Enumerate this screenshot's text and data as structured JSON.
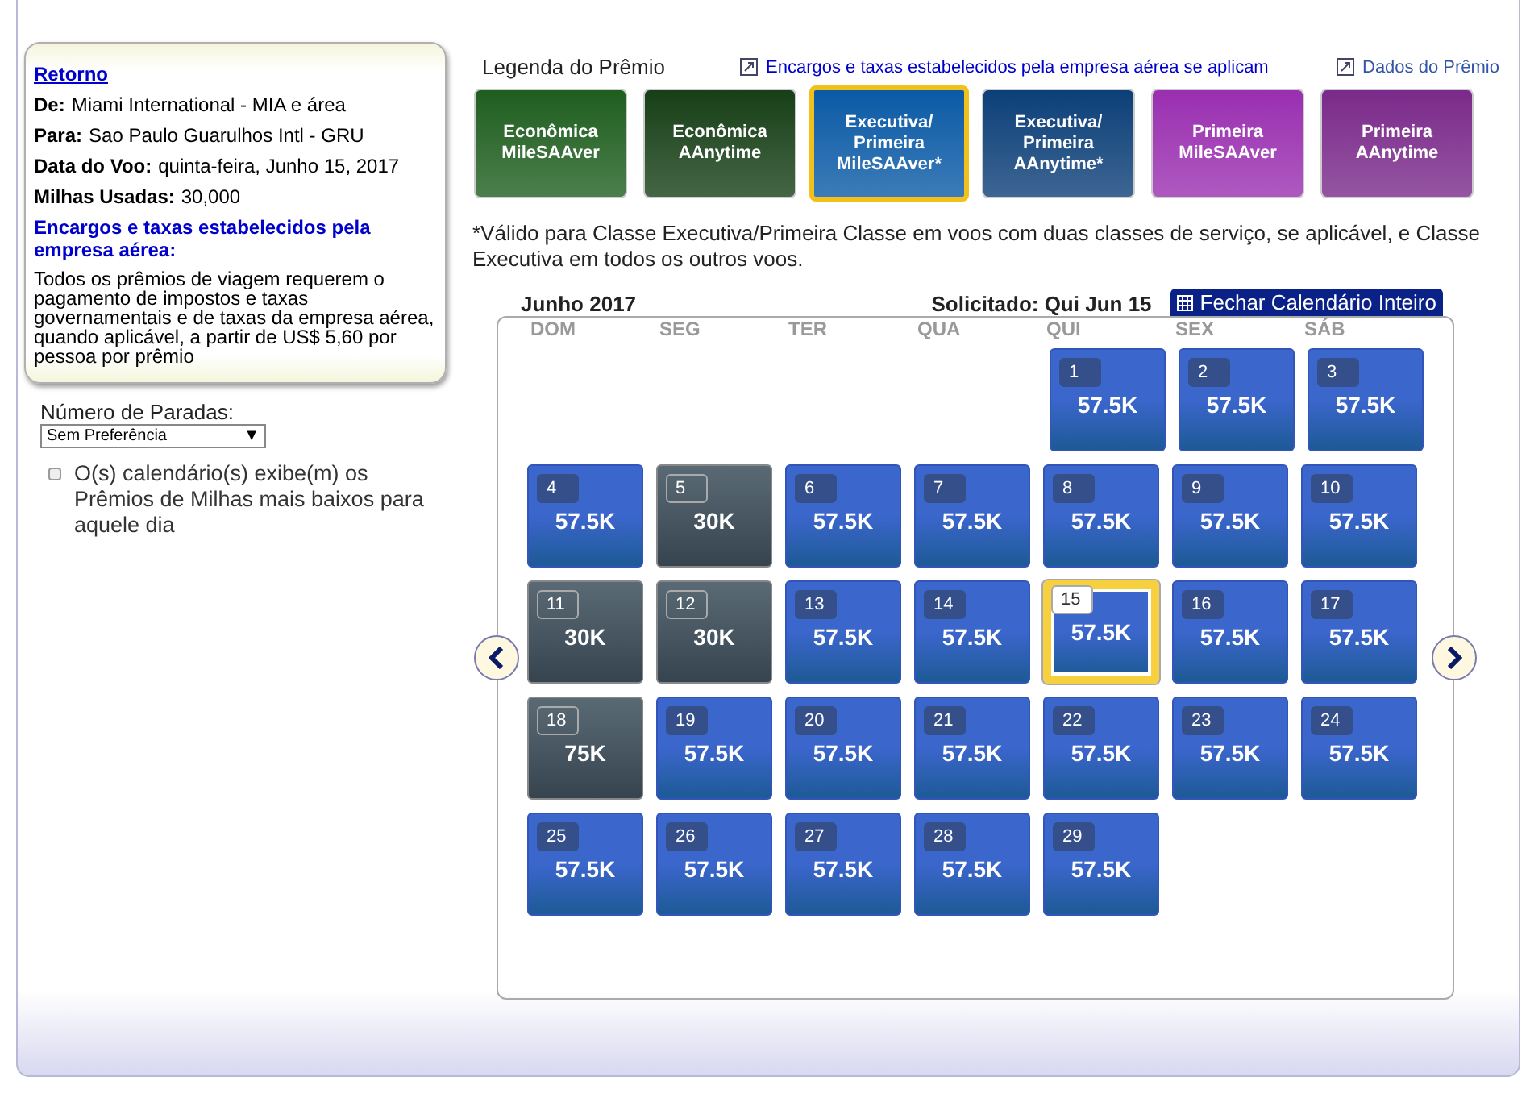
{
  "summary": {
    "back_link": "Retorno",
    "fields": [
      {
        "label": "De:",
        "value": "Miami International - MIA e área"
      },
      {
        "label": "Para:",
        "value": "Sao Paulo Guarulhos Intl - GRU"
      },
      {
        "label": "Data do Voo:",
        "value": "quinta-feira, Junho 15, 2017"
      },
      {
        "label": "Milhas Usadas:",
        "value": "30,000"
      }
    ],
    "fees_title": "Encargos e taxas estabelecidos pela empresa aérea:",
    "fees_text": "Todos os prêmios de viagem requerem o pagamento de impostos e taxas governamentais e de taxas da empresa aérea, quando aplicável, a partir de US$ 5,60 por pessoa por prêmio"
  },
  "stops": {
    "label": "Número de Paradas:",
    "value": "Sem Preferência",
    "arrow": "▼"
  },
  "lowest_option": {
    "label": "O(s) calendário(s) exibe(m) os Prêmios de Milhas mais baixos para aquele dia",
    "checked": false
  },
  "legend": {
    "title": "Legenda do Prêmio",
    "fees_link": "Encargos e taxas estabelecidos pela empresa aérea se aplicam",
    "data_link": "Dados do Prêmio",
    "awards": [
      {
        "lines": [
          "Econômica",
          "MileSAAver"
        ],
        "color": "#1f5e1f",
        "selected": false
      },
      {
        "lines": [
          "Econômica",
          "AAnytime"
        ],
        "color": "#173f17",
        "selected": false
      },
      {
        "lines": [
          "Executiva/",
          "Primeira",
          "MileSAAver*"
        ],
        "color": "#0b5aa6",
        "selected": true
      },
      {
        "lines": [
          "Executiva/",
          "Primeira",
          "AAnytime*"
        ],
        "color": "#0c3f78",
        "selected": false
      },
      {
        "lines": [
          "Primeira",
          "MileSAAver"
        ],
        "color": "#9a2fb0",
        "selected": false
      },
      {
        "lines": [
          "Primeira",
          "AAnytime"
        ],
        "color": "#7a2a8a",
        "selected": false
      }
    ]
  },
  "note": "*Válido para Classe Executiva/Primeira Classe em voos com duas classes de serviço, se aplicável, e Classe Executiva em todos os outros voos.",
  "calendar": {
    "month": "Junho 2017",
    "requested": "Solicitado: Qui Jun 15",
    "close_button": "Fechar Calendário Inteiro",
    "weekdays": [
      "DOM",
      "SEG",
      "TER",
      "QUA",
      "QUI",
      "SEX",
      "SÁB"
    ],
    "weeks": [
      {
        "days": [
          {
            "day": "1",
            "price": "57.5K",
            "kind": "lit",
            "selected": false
          },
          {
            "day": "2",
            "price": "57.5K",
            "kind": "lit",
            "selected": false
          },
          {
            "day": "3",
            "price": "57.5K",
            "kind": "lit",
            "selected": false
          }
        ]
      },
      {
        "days": [
          {
            "day": "4",
            "price": "57.5K",
            "kind": "lit",
            "selected": false
          },
          {
            "day": "5",
            "price": "30K",
            "kind": "dim",
            "selected": false
          },
          {
            "day": "6",
            "price": "57.5K",
            "kind": "lit",
            "selected": false
          },
          {
            "day": "7",
            "price": "57.5K",
            "kind": "lit",
            "selected": false
          },
          {
            "day": "8",
            "price": "57.5K",
            "kind": "lit",
            "selected": false
          },
          {
            "day": "9",
            "price": "57.5K",
            "kind": "lit",
            "selected": false
          },
          {
            "day": "10",
            "price": "57.5K",
            "kind": "lit",
            "selected": false
          }
        ]
      },
      {
        "days": [
          {
            "day": "11",
            "price": "30K",
            "kind": "dim",
            "selected": false
          },
          {
            "day": "12",
            "price": "30K",
            "kind": "dim",
            "selected": false
          },
          {
            "day": "13",
            "price": "57.5K",
            "kind": "lit",
            "selected": false
          },
          {
            "day": "14",
            "price": "57.5K",
            "kind": "lit",
            "selected": false
          },
          {
            "day": "15",
            "price": "57.5K",
            "kind": "lit",
            "selected": true
          },
          {
            "day": "16",
            "price": "57.5K",
            "kind": "lit",
            "selected": false
          },
          {
            "day": "17",
            "price": "57.5K",
            "kind": "lit",
            "selected": false
          }
        ]
      },
      {
        "days": [
          {
            "day": "18",
            "price": "75K",
            "kind": "dim",
            "selected": false
          },
          {
            "day": "19",
            "price": "57.5K",
            "kind": "lit",
            "selected": false
          },
          {
            "day": "20",
            "price": "57.5K",
            "kind": "lit",
            "selected": false
          },
          {
            "day": "21",
            "price": "57.5K",
            "kind": "lit",
            "selected": false
          },
          {
            "day": "22",
            "price": "57.5K",
            "kind": "lit",
            "selected": false
          },
          {
            "day": "23",
            "price": "57.5K",
            "kind": "lit",
            "selected": false
          },
          {
            "day": "24",
            "price": "57.5K",
            "kind": "lit",
            "selected": false
          }
        ]
      },
      {
        "days": [
          {
            "day": "25",
            "price": "57.5K",
            "kind": "lit",
            "selected": false
          },
          {
            "day": "26",
            "price": "57.5K",
            "kind": "lit",
            "selected": false
          },
          {
            "day": "27",
            "price": "57.5K",
            "kind": "lit",
            "selected": false
          },
          {
            "day": "28",
            "price": "57.5K",
            "kind": "lit",
            "selected": false
          },
          {
            "day": "29",
            "price": "57.5K",
            "kind": "lit",
            "selected": false
          }
        ]
      }
    ]
  }
}
